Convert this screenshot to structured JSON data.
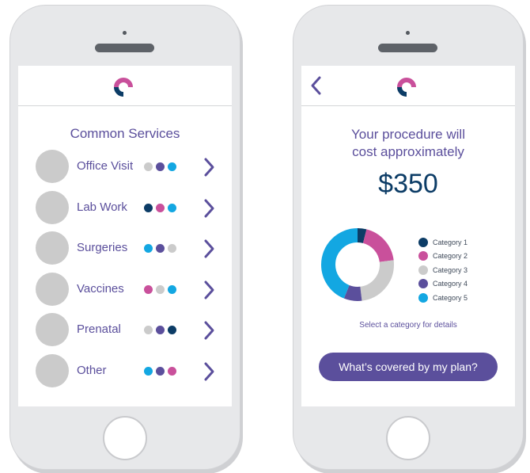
{
  "colors": {
    "navy": "#0c3c66",
    "purple": "#5b4f9c",
    "magenta": "#c9509b",
    "gray": "#cbcbcb",
    "cyan": "#13a7e2"
  },
  "left_screen": {
    "title": "Common Services",
    "services": [
      {
        "label": "Office Visit",
        "dots": [
          "gray",
          "purple",
          "cyan"
        ]
      },
      {
        "label": "Lab Work",
        "dots": [
          "navy",
          "magenta",
          "cyan"
        ]
      },
      {
        "label": "Surgeries",
        "dots": [
          "cyan",
          "purple",
          "gray"
        ]
      },
      {
        "label": "Vaccines",
        "dots": [
          "magenta",
          "gray",
          "cyan"
        ]
      },
      {
        "label": "Prenatal",
        "dots": [
          "gray",
          "purple",
          "navy"
        ]
      },
      {
        "label": "Other",
        "dots": [
          "cyan",
          "purple",
          "magenta"
        ]
      }
    ]
  },
  "right_screen": {
    "heading_line1": "Your procedure will",
    "heading_line2": "cost approximately",
    "price": "$350",
    "chart_data": {
      "type": "pie",
      "categories": [
        "Category 1",
        "Category 2",
        "Category 3",
        "Category 4",
        "Category 5"
      ],
      "values": [
        4,
        19,
        25,
        8,
        44
      ],
      "colors": [
        "#0c3c66",
        "#c9509b",
        "#cbcbcb",
        "#5b4f9c",
        "#13a7e2"
      ],
      "legend_position": "right"
    },
    "hint": "Select a category for details",
    "cta_label": "What’s covered by my plan?"
  }
}
